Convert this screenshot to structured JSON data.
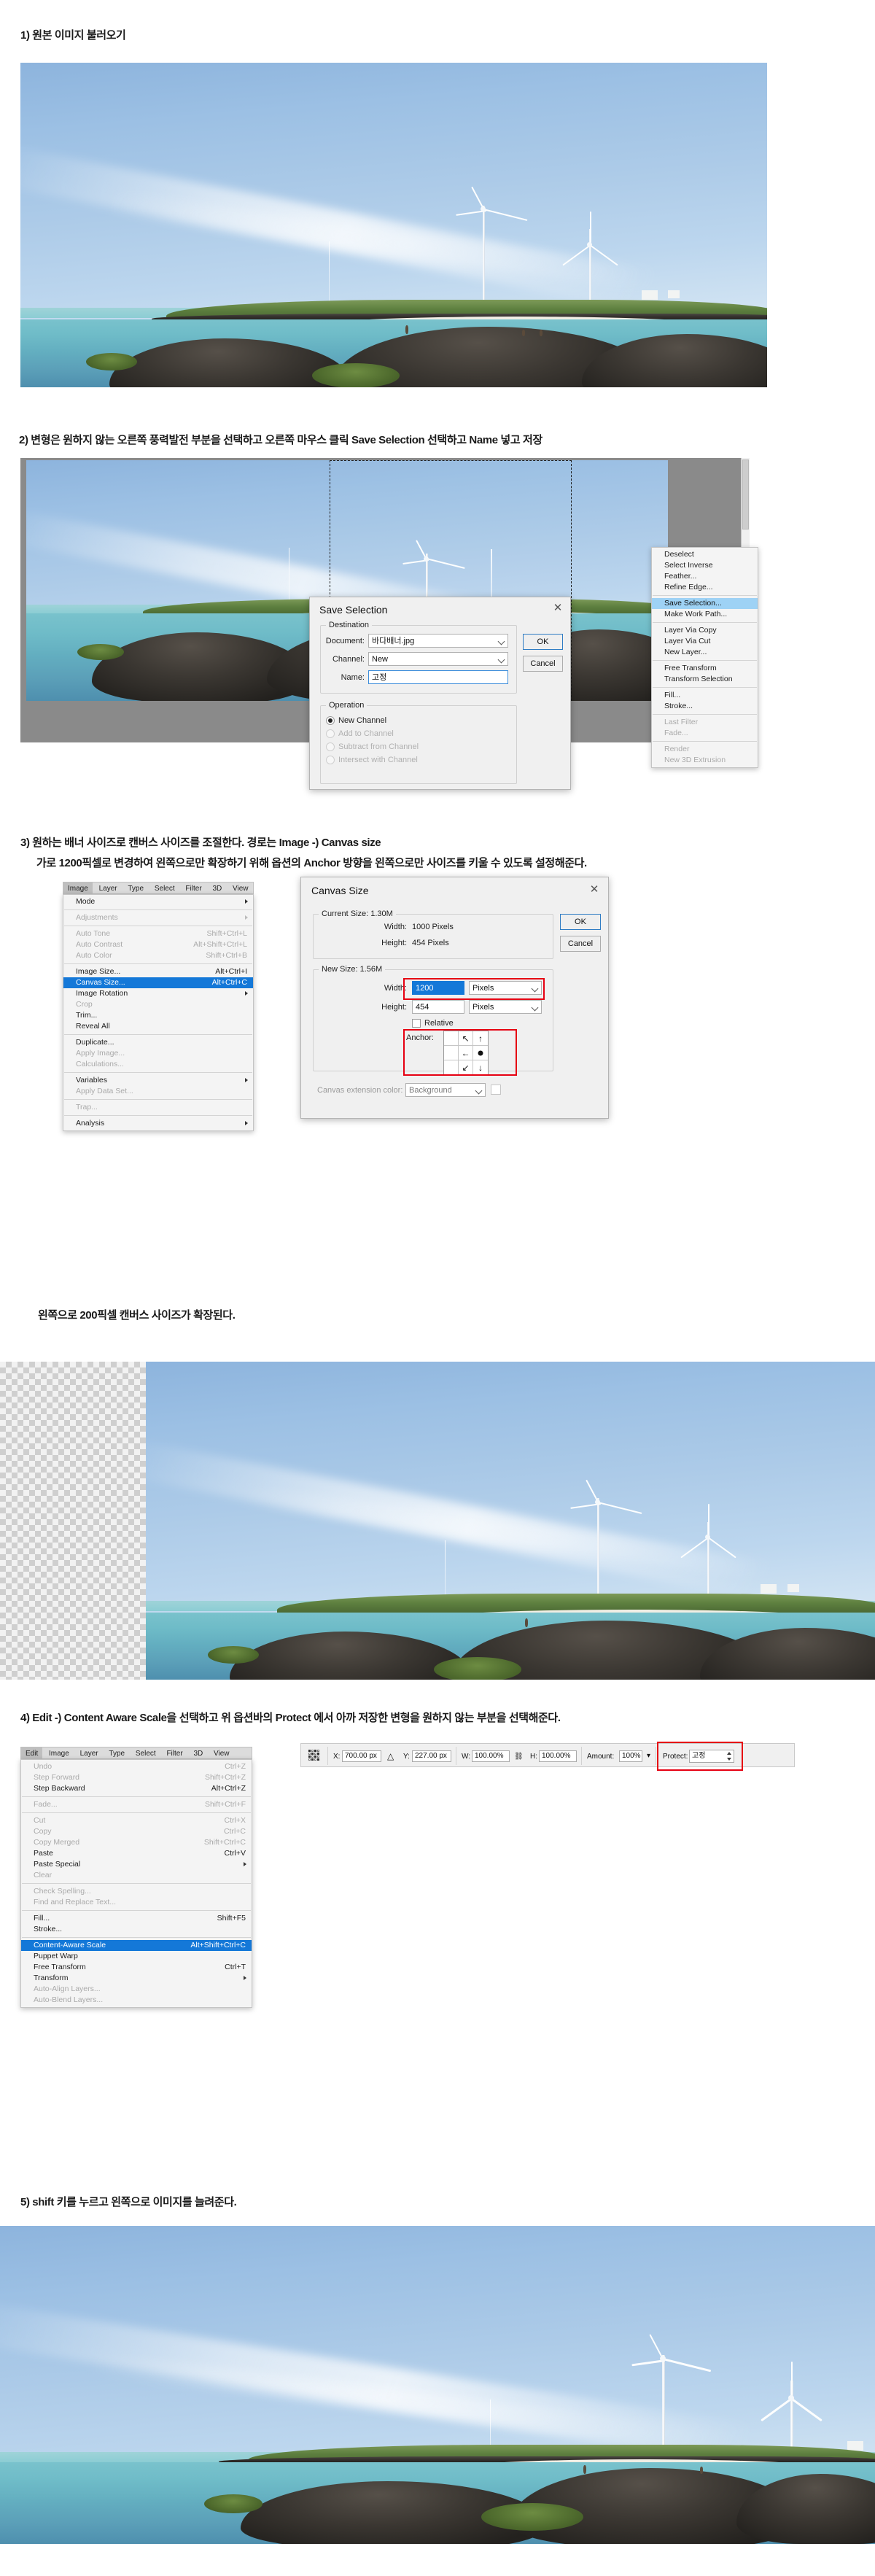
{
  "steps": {
    "s1": "1) 원본 이미지 불러오기",
    "s2": "2) 변형은 원하지 않는 오른쪽 풍력발전 부분을 선택하고 오른쪽 마우스 클릭 Save Selection 선택하고 Name 넣고 저장",
    "s3_line1": "3) 원하는 배너 사이즈로 캔버스 사이즈를 조절한다. 경로는 Image -) Canvas size",
    "s3_line2": "가로 1200픽셀로 변경하여 왼쪽으로만 확장하기 위해 옵션의 Anchor 방향을 왼쪽으로만 사이즈를 키울 수 있도록 설정해준다.",
    "s3_note": "왼쪽으로 200픽셀 캔버스 사이즈가 확장된다.",
    "s4": "4) Edit -) Content Aware Scale을 선택하고 위 옵션바의 Protect 에서 아까 저장한 변형을 원하지 않는 부분을 선택해준다.",
    "s5": "5) shift 키를 누르고 왼쪽으로 이미지를 늘려준다."
  },
  "context_menu": {
    "items": [
      {
        "label": "Deselect",
        "state": "normal"
      },
      {
        "label": "Select Inverse",
        "state": "normal"
      },
      {
        "label": "Feather...",
        "state": "normal"
      },
      {
        "label": "Refine Edge...",
        "state": "normal"
      },
      {
        "label": "Save Selection...",
        "state": "selected"
      },
      {
        "label": "Make Work Path...",
        "state": "normal"
      },
      {
        "label": "Layer Via Copy",
        "state": "normal"
      },
      {
        "label": "Layer Via Cut",
        "state": "normal"
      },
      {
        "label": "New Layer...",
        "state": "normal"
      },
      {
        "label": "Free Transform",
        "state": "normal"
      },
      {
        "label": "Transform Selection",
        "state": "normal"
      },
      {
        "label": "Fill...",
        "state": "normal"
      },
      {
        "label": "Stroke...",
        "state": "normal"
      },
      {
        "label": "Last Filter",
        "state": "disabled"
      },
      {
        "label": "Fade...",
        "state": "disabled"
      },
      {
        "label": "Render",
        "state": "disabled"
      },
      {
        "label": "New 3D Extrusion",
        "state": "disabled"
      }
    ]
  },
  "save_selection_dialog": {
    "title": "Save Selection",
    "close_icon": "✕",
    "destination_legend": "Destination",
    "document_label": "Document:",
    "document_value": "바다배너.jpg",
    "channel_label": "Channel:",
    "channel_value": "New",
    "name_label": "Name:",
    "name_value": "고정",
    "operation_legend": "Operation",
    "operations": [
      {
        "label": "New Channel",
        "selected": true,
        "disabled": false
      },
      {
        "label": "Add to Channel",
        "selected": false,
        "disabled": true
      },
      {
        "label": "Subtract from Channel",
        "selected": false,
        "disabled": true
      },
      {
        "label": "Intersect with Channel",
        "selected": false,
        "disabled": true
      }
    ],
    "ok_label": "OK",
    "cancel_label": "Cancel"
  },
  "image_menubar": {
    "items": [
      "Image",
      "Layer",
      "Type",
      "Select",
      "Filter",
      "3D",
      "View"
    ],
    "active": "Image"
  },
  "image_menu": {
    "groups": [
      [
        {
          "label": "Mode",
          "shortcut": "",
          "submenu": true,
          "state": "normal"
        }
      ],
      [
        {
          "label": "Adjustments",
          "shortcut": "",
          "submenu": true,
          "state": "disabled"
        }
      ],
      [
        {
          "label": "Auto Tone",
          "shortcut": "Shift+Ctrl+L",
          "submenu": false,
          "state": "disabled"
        },
        {
          "label": "Auto Contrast",
          "shortcut": "Alt+Shift+Ctrl+L",
          "submenu": false,
          "state": "disabled"
        },
        {
          "label": "Auto Color",
          "shortcut": "Shift+Ctrl+B",
          "submenu": false,
          "state": "disabled"
        }
      ],
      [
        {
          "label": "Image Size...",
          "shortcut": "Alt+Ctrl+I",
          "submenu": false,
          "state": "normal"
        },
        {
          "label": "Canvas Size...",
          "shortcut": "Alt+Ctrl+C",
          "submenu": false,
          "state": "selected"
        },
        {
          "label": "Image Rotation",
          "shortcut": "",
          "submenu": true,
          "state": "normal"
        },
        {
          "label": "Crop",
          "shortcut": "",
          "submenu": false,
          "state": "disabled"
        },
        {
          "label": "Trim...",
          "shortcut": "",
          "submenu": false,
          "state": "normal"
        },
        {
          "label": "Reveal All",
          "shortcut": "",
          "submenu": false,
          "state": "normal"
        }
      ],
      [
        {
          "label": "Duplicate...",
          "shortcut": "",
          "submenu": false,
          "state": "normal"
        },
        {
          "label": "Apply Image...",
          "shortcut": "",
          "submenu": false,
          "state": "disabled"
        },
        {
          "label": "Calculations...",
          "shortcut": "",
          "submenu": false,
          "state": "disabled"
        }
      ],
      [
        {
          "label": "Variables",
          "shortcut": "",
          "submenu": true,
          "state": "normal"
        },
        {
          "label": "Apply Data Set...",
          "shortcut": "",
          "submenu": false,
          "state": "disabled"
        }
      ],
      [
        {
          "label": "Trap...",
          "shortcut": "",
          "submenu": false,
          "state": "disabled"
        }
      ],
      [
        {
          "label": "Analysis",
          "shortcut": "",
          "submenu": true,
          "state": "normal"
        }
      ]
    ]
  },
  "canvas_size_dialog": {
    "title": "Canvas Size",
    "close_icon": "✕",
    "current_size_legend": "Current Size: 1.30M",
    "current_width_label": "Width:",
    "current_width_value": "1000 Pixels",
    "current_height_label": "Height:",
    "current_height_value": "454 Pixels",
    "new_size_legend": "New Size: 1.56M",
    "new_width_label": "Width:",
    "new_width_value": "1200",
    "new_width_unit": "Pixels",
    "new_height_label": "Height:",
    "new_height_value": "454",
    "new_height_unit": "Pixels",
    "relative_label": "Relative",
    "anchor_label": "Anchor:",
    "anchor_arrows": [
      "",
      "↖",
      "↑",
      "",
      "←",
      "●",
      "",
      "↙",
      "↓"
    ],
    "extension_color_label": "Canvas extension color:",
    "extension_color_value": "Background",
    "ok_label": "OK",
    "cancel_label": "Cancel"
  },
  "edit_menubar": {
    "items": [
      "Edit",
      "Image",
      "Layer",
      "Type",
      "Select",
      "Filter",
      "3D",
      "View"
    ],
    "active": "Edit"
  },
  "edit_menu": {
    "groups": [
      [
        {
          "label": "Undo",
          "shortcut": "Ctrl+Z",
          "submenu": false,
          "state": "disabled"
        },
        {
          "label": "Step Forward",
          "shortcut": "Shift+Ctrl+Z",
          "submenu": false,
          "state": "disabled"
        },
        {
          "label": "Step Backward",
          "shortcut": "Alt+Ctrl+Z",
          "submenu": false,
          "state": "normal"
        }
      ],
      [
        {
          "label": "Fade...",
          "shortcut": "Shift+Ctrl+F",
          "submenu": false,
          "state": "disabled"
        }
      ],
      [
        {
          "label": "Cut",
          "shortcut": "Ctrl+X",
          "submenu": false,
          "state": "disabled"
        },
        {
          "label": "Copy",
          "shortcut": "Ctrl+C",
          "submenu": false,
          "state": "disabled"
        },
        {
          "label": "Copy Merged",
          "shortcut": "Shift+Ctrl+C",
          "submenu": false,
          "state": "disabled"
        },
        {
          "label": "Paste",
          "shortcut": "Ctrl+V",
          "submenu": false,
          "state": "normal"
        },
        {
          "label": "Paste Special",
          "shortcut": "",
          "submenu": true,
          "state": "normal"
        },
        {
          "label": "Clear",
          "shortcut": "",
          "submenu": false,
          "state": "disabled"
        }
      ],
      [
        {
          "label": "Check Spelling...",
          "shortcut": "",
          "submenu": false,
          "state": "disabled"
        },
        {
          "label": "Find and Replace Text...",
          "shortcut": "",
          "submenu": false,
          "state": "disabled"
        }
      ],
      [
        {
          "label": "Fill...",
          "shortcut": "Shift+F5",
          "submenu": false,
          "state": "normal"
        },
        {
          "label": "Stroke...",
          "shortcut": "",
          "submenu": false,
          "state": "normal"
        }
      ],
      [
        {
          "label": "Content-Aware Scale",
          "shortcut": "Alt+Shift+Ctrl+C",
          "submenu": false,
          "state": "selected"
        },
        {
          "label": "Puppet Warp",
          "shortcut": "",
          "submenu": false,
          "state": "normal"
        },
        {
          "label": "Free Transform",
          "shortcut": "Ctrl+T",
          "submenu": false,
          "state": "normal"
        },
        {
          "label": "Transform",
          "shortcut": "",
          "submenu": true,
          "state": "normal"
        },
        {
          "label": "Auto-Align Layers...",
          "shortcut": "",
          "submenu": false,
          "state": "disabled"
        },
        {
          "label": "Auto-Blend Layers...",
          "shortcut": "",
          "submenu": false,
          "state": "disabled"
        }
      ]
    ]
  },
  "options_bar": {
    "reference_point_icon": "reference-point-grid",
    "x_label": "X:",
    "x_value": "700.00 px",
    "delta_icon": "△",
    "y_label": "Y:",
    "y_value": "227.00 px",
    "w_label": "W:",
    "w_value": "100.00%",
    "link_icon": "⛓",
    "h_label": "H:",
    "h_value": "100.00%",
    "amount_label": "Amount:",
    "amount_value": "100%",
    "protect_label": "Protect:",
    "protect_value": "고정"
  },
  "colors": {
    "selection_blue": "#1478d8",
    "selection_light_blue": "#9ed2f5",
    "highlight_red": "#e60012",
    "canvas_gray": "#8a8a8a",
    "dialog_bg": "#f0f0f0"
  }
}
